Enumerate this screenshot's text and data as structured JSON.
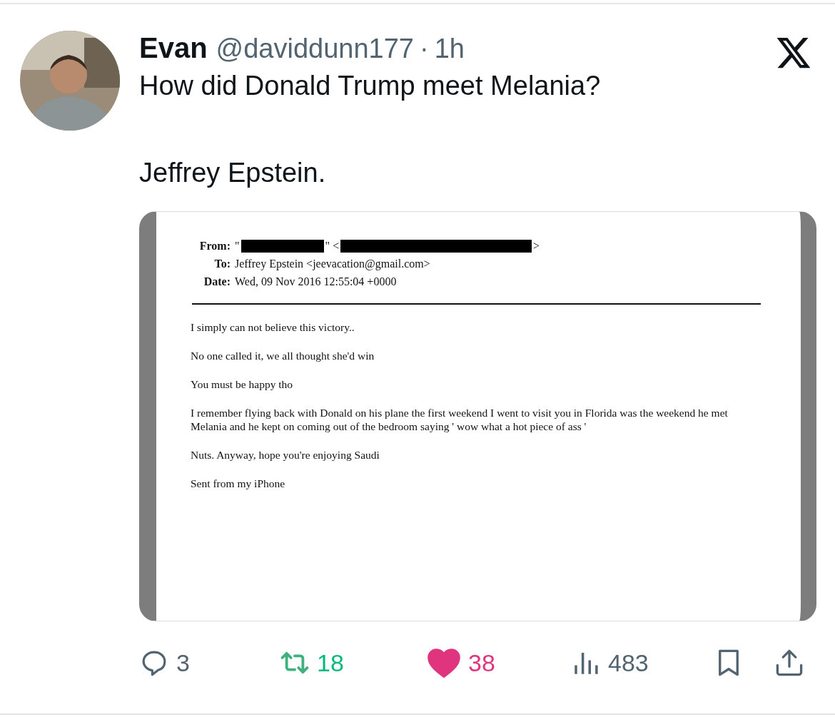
{
  "author": {
    "name": "Evan",
    "handle": "@daviddunn177",
    "separator": "·",
    "time": "1h"
  },
  "text": [
    "How did Donald Trump meet Melania?",
    "Jeffrey Epstein."
  ],
  "document": {
    "headers": [
      {
        "label": "From:",
        "parts": [
          {
            "kind": "text",
            "text": "\""
          },
          {
            "kind": "redacted"
          },
          {
            "kind": "text",
            "text": "\" <"
          },
          {
            "kind": "redacted"
          },
          {
            "kind": "text",
            "text": ">"
          }
        ]
      },
      {
        "label": "To:",
        "parts": [
          {
            "kind": "text",
            "text": "Jeffrey Epstein <jeevacation@gmail.com>"
          }
        ]
      },
      {
        "label": "Date:",
        "parts": [
          {
            "kind": "text",
            "text": "Wed, 09 Nov 2016 12:55:04 +0000"
          }
        ]
      }
    ],
    "body": [
      "I simply can not believe this victory..",
      "No one called it, we all thought she'd win",
      "You must be happy tho",
      "I remember flying back with Donald on his plane the first weekend I went to visit you in Florida was the weekend he met Melania and he kept on coming out of the bedroom saying ' wow what a hot piece of ass '",
      "Nuts. Anyway, hope you're enjoying Saudi",
      "Sent from my iPhone"
    ]
  },
  "actions": {
    "replies": "3",
    "reposts": "18",
    "reposted": true,
    "likes": "38",
    "liked": true,
    "views": "483",
    "bookmarked": false
  }
}
